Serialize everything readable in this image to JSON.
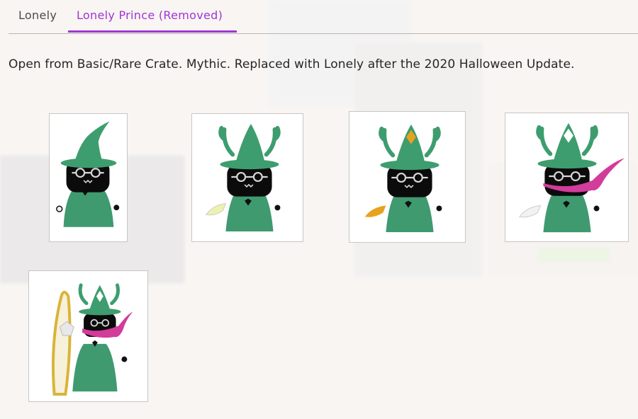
{
  "tabs": [
    {
      "label": "Lonely",
      "selected": false
    },
    {
      "label": "Lonely Prince (Removed)",
      "selected": true
    }
  ],
  "description": "Open from Basic/Rare Crate. Mythic. Replaced with Lonely after the 2020 Halloween Update.",
  "colors": {
    "accent": "#a135d6",
    "body_green": "#3f9a70",
    "hat_green": "#3e9d6e",
    "scarf_pink": "#d23c9a",
    "gem_orange": "#e7a21f"
  },
  "images": [
    {
      "name": "lonely-prince-variant-1"
    },
    {
      "name": "lonely-prince-variant-2"
    },
    {
      "name": "lonely-prince-variant-3"
    },
    {
      "name": "lonely-prince-variant-4"
    },
    {
      "name": "lonely-prince-variant-5"
    }
  ]
}
